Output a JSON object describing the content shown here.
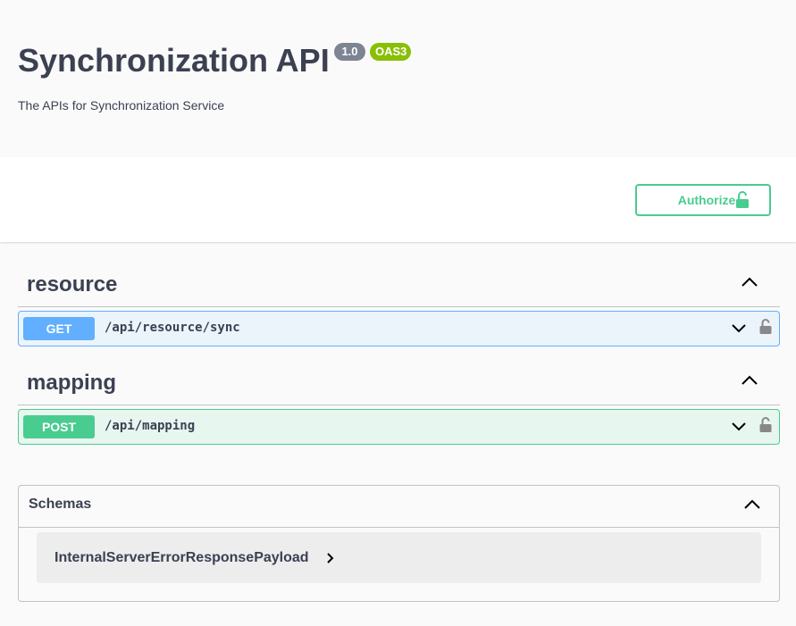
{
  "info": {
    "title": "Synchronization API",
    "version": "1.0",
    "oas_badge": "OAS3",
    "description": "The APIs for Synchronization Service"
  },
  "auth": {
    "authorize_label": "Authorize",
    "icon": "unlocked-lock-icon"
  },
  "tags": [
    {
      "name": "resource",
      "operations": [
        {
          "method": "GET",
          "path": "/api/resource/sync"
        }
      ]
    },
    {
      "name": "mapping",
      "operations": [
        {
          "method": "POST",
          "path": "/api/mapping"
        }
      ]
    }
  ],
  "schemas": {
    "title": "Schemas",
    "items": [
      "InternalServerErrorResponsePayload"
    ]
  },
  "colors": {
    "get": "#61affe",
    "post": "#49cc90",
    "version_badge": "#7d8492",
    "oas_badge": "#89bf04"
  }
}
